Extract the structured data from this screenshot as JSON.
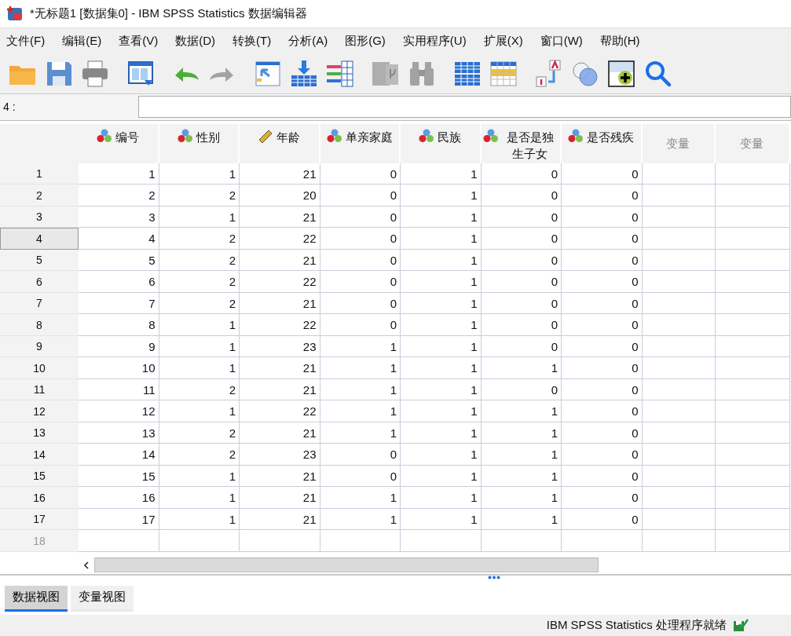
{
  "window": {
    "title": "*无标题1 [数据集0] - IBM SPSS Statistics 数据编辑器"
  },
  "menu": [
    {
      "label": "文件(F)"
    },
    {
      "label": "编辑(E)"
    },
    {
      "label": "查看(V)"
    },
    {
      "label": "数据(D)"
    },
    {
      "label": "转换(T)"
    },
    {
      "label": "分析(A)"
    },
    {
      "label": "图形(G)"
    },
    {
      "label": "实用程序(U)"
    },
    {
      "label": "扩展(X)"
    },
    {
      "label": "窗口(W)"
    },
    {
      "label": "帮助(H)"
    }
  ],
  "toolbar": [
    {
      "kind": "open",
      "disabled": false
    },
    {
      "kind": "save",
      "disabled": false
    },
    {
      "kind": "print",
      "disabled": false
    },
    {
      "kind": "dialog",
      "disabled": false
    },
    {
      "kind": "undo",
      "disabled": false
    },
    {
      "kind": "redo",
      "disabled": true
    },
    {
      "kind": "goto-case",
      "disabled": false
    },
    {
      "kind": "goto-var",
      "disabled": false
    },
    {
      "kind": "variables",
      "disabled": false
    },
    {
      "kind": "stats",
      "disabled": true
    },
    {
      "kind": "find",
      "disabled": true
    },
    {
      "kind": "split",
      "disabled": false
    },
    {
      "kind": "select",
      "disabled": false
    },
    {
      "kind": "labels",
      "disabled": false
    },
    {
      "kind": "sets",
      "disabled": false
    },
    {
      "kind": "add",
      "disabled": false
    },
    {
      "kind": "search",
      "disabled": false
    }
  ],
  "cell_editor": {
    "label": "4 :"
  },
  "columns": [
    {
      "label": "编号",
      "kind": "nominal"
    },
    {
      "label": "性别",
      "kind": "nominal"
    },
    {
      "label": "年龄",
      "kind": "scale"
    },
    {
      "label": "单亲家庭",
      "kind": "nominal"
    },
    {
      "label": "民族",
      "kind": "nominal"
    },
    {
      "label": "是否是独生子女",
      "kind": "nominal"
    },
    {
      "label": "是否残疾",
      "kind": "nominal"
    },
    {
      "label": "变量",
      "kind": "empty"
    },
    {
      "label": "变量",
      "kind": "empty"
    }
  ],
  "rows": [
    {
      "label": "1",
      "selected": false,
      "empty": false,
      "cells": [
        "1",
        "1",
        "21",
        "0",
        "1",
        "0",
        "0"
      ]
    },
    {
      "label": "2",
      "selected": false,
      "empty": false,
      "cells": [
        "2",
        "2",
        "20",
        "0",
        "1",
        "0",
        "0"
      ]
    },
    {
      "label": "3",
      "selected": false,
      "empty": false,
      "cells": [
        "3",
        "1",
        "21",
        "0",
        "1",
        "0",
        "0"
      ]
    },
    {
      "label": "4",
      "selected": true,
      "empty": false,
      "cells": [
        "4",
        "2",
        "22",
        "0",
        "1",
        "0",
        "0"
      ]
    },
    {
      "label": "5",
      "selected": false,
      "empty": false,
      "cells": [
        "5",
        "2",
        "21",
        "0",
        "1",
        "0",
        "0"
      ]
    },
    {
      "label": "6",
      "selected": false,
      "empty": false,
      "cells": [
        "6",
        "2",
        "22",
        "0",
        "1",
        "0",
        "0"
      ]
    },
    {
      "label": "7",
      "selected": false,
      "empty": false,
      "cells": [
        "7",
        "2",
        "21",
        "0",
        "1",
        "0",
        "0"
      ]
    },
    {
      "label": "8",
      "selected": false,
      "empty": false,
      "cells": [
        "8",
        "1",
        "22",
        "0",
        "1",
        "0",
        "0"
      ]
    },
    {
      "label": "9",
      "selected": false,
      "empty": false,
      "cells": [
        "9",
        "1",
        "23",
        "1",
        "1",
        "0",
        "0"
      ]
    },
    {
      "label": "10",
      "selected": false,
      "empty": false,
      "cells": [
        "10",
        "1",
        "21",
        "1",
        "1",
        "1",
        "0"
      ]
    },
    {
      "label": "11",
      "selected": false,
      "empty": false,
      "cells": [
        "11",
        "2",
        "21",
        "1",
        "1",
        "0",
        "0"
      ]
    },
    {
      "label": "12",
      "selected": false,
      "empty": false,
      "cells": [
        "12",
        "1",
        "22",
        "1",
        "1",
        "1",
        "0"
      ]
    },
    {
      "label": "13",
      "selected": false,
      "empty": false,
      "cells": [
        "13",
        "2",
        "21",
        "1",
        "1",
        "1",
        "0"
      ]
    },
    {
      "label": "14",
      "selected": false,
      "empty": false,
      "cells": [
        "14",
        "2",
        "23",
        "0",
        "1",
        "1",
        "0"
      ]
    },
    {
      "label": "15",
      "selected": false,
      "empty": false,
      "cells": [
        "15",
        "1",
        "21",
        "0",
        "1",
        "1",
        "0"
      ]
    },
    {
      "label": "16",
      "selected": false,
      "empty": false,
      "cells": [
        "16",
        "1",
        "21",
        "1",
        "1",
        "1",
        "0"
      ]
    },
    {
      "label": "17",
      "selected": false,
      "empty": false,
      "cells": [
        "17",
        "1",
        "21",
        "1",
        "1",
        "1",
        "0"
      ]
    },
    {
      "label": "18",
      "selected": false,
      "empty": true
    }
  ],
  "view_tabs": [
    {
      "label": "数据视图",
      "selected": true
    },
    {
      "label": "变量视图",
      "selected": false
    }
  ],
  "status_bar": {
    "text": "IBM SPSS Statistics 处理程序就绪"
  }
}
